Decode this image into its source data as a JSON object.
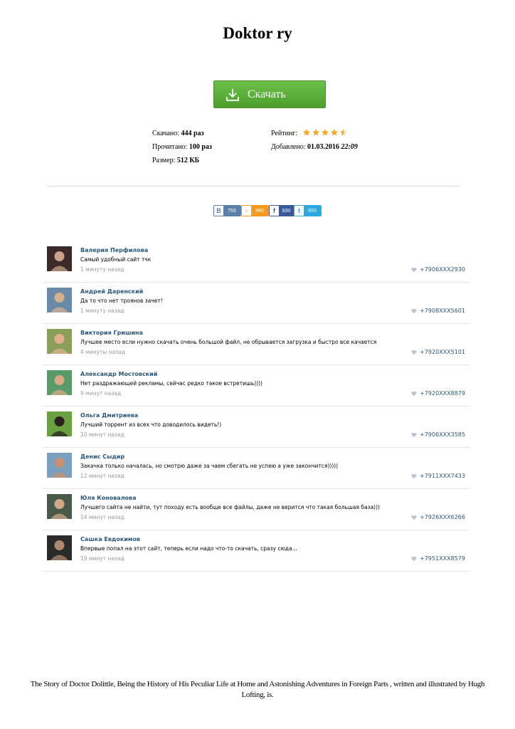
{
  "title": "Doktor ry",
  "download": {
    "label": "Скачать",
    "icon": "download-icon",
    "color": "#5aae3a"
  },
  "stats": {
    "downloaded_label": "Скачано:",
    "downloaded_value": "444 раз",
    "read_label": "Прочитано:",
    "read_value": "100 раз",
    "size_label": "Размер:",
    "size_value": "512 КБ",
    "rating_label": "Рейтинг:",
    "rating_value": 4.5,
    "rating_max": 5,
    "rating_color": "#f5a623",
    "added_label": "Добавлено:",
    "added_date": "01.03.2016",
    "added_time": "22:09"
  },
  "share": [
    {
      "network": "vk",
      "icon": "В",
      "count": "755",
      "color": "#5b7fa6"
    },
    {
      "network": "ok",
      "icon": "ok",
      "count": "990",
      "color": "#f59a1e"
    },
    {
      "network": "fb",
      "icon": "f",
      "count": "930",
      "color": "#3b5998"
    },
    {
      "network": "tw",
      "icon": "t",
      "count": "650",
      "color": "#2ca7e0"
    }
  ],
  "comments": [
    {
      "name": "Валерия Перфилова",
      "text": "Самый удобный сайт тчк",
      "time": "1 минуту назад",
      "phone": "+7906XXX2930"
    },
    {
      "name": "Андрей Даренский",
      "text": "Да то что нет троянов зачет!",
      "time": "1 минуту назад",
      "phone": "+7908XXX5601"
    },
    {
      "name": "Виктория Гришина",
      "text": "Лучшее место если нужно скачать очень большой файл, не обрывается загрузка и быстро все качается",
      "time": "4 минуты назад",
      "phone": "+7920XXX5101"
    },
    {
      "name": "Александр Мостовский",
      "text": "Нет раздражающей рекламы, сейчас редко такое встретишь))))",
      "time": "9 минут назад",
      "phone": "+7920XXX8879"
    },
    {
      "name": "Ольга Дмитриева",
      "text": "Лучший торрент из всех что доводилось видеть!)",
      "time": "10 минут назад",
      "phone": "+7906XXX3585"
    },
    {
      "name": "Денис Сыдир",
      "text": "Закачка только началась, но смотрю даже за чаем сбегать не успею а уже закончится)))))",
      "time": "12 минут назад",
      "phone": "+7911XXX7433"
    },
    {
      "name": "Юля Коновалова",
      "text": "Лучшего сайта не найти, тут походу есть вообще все файлы, даже не верится что такая большая база)))",
      "time": "14 минут назад",
      "phone": "+7926XXX6266"
    },
    {
      "name": "Сашка Евдокимов",
      "text": "Впервые попал на этот сайт, теперь если надо что-то скачать, сразу сюда...",
      "time": "19 минут назад",
      "phone": "+7951XXX8579"
    }
  ],
  "footer": "The Story of Doctor Dolittle, Being the History of His Peculiar Life at Home and Astonishing Adventures in Foreign Parts , written and illustrated by Hugh Lofting, is."
}
